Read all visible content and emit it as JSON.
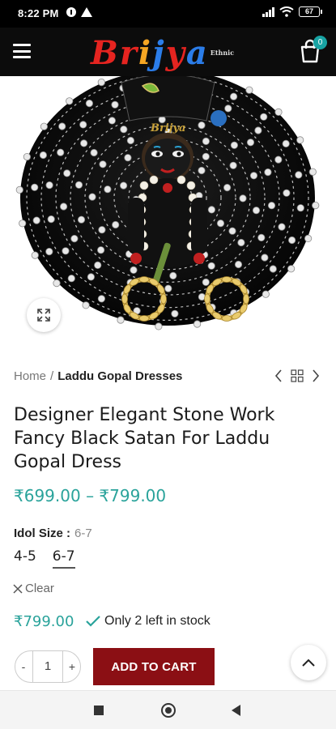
{
  "status_bar": {
    "time": "8:22 PM",
    "battery": "67"
  },
  "header": {
    "logo": {
      "letters": [
        "B",
        "r",
        "i",
        "j",
        "y",
        "a"
      ],
      "trademark": "Ethnic",
      "colors": [
        "#e52420",
        "#e52420",
        "#f5a623",
        "#2b7de9",
        "#e52420",
        "#2b7de9"
      ]
    },
    "cart_count": "0"
  },
  "breadcrumb": {
    "home": "Home",
    "separator": "/",
    "current": "Laddu Gopal Dresses"
  },
  "product": {
    "title": "Designer Elegant Stone Work Fancy Black Satan For Laddu Gopal Dress",
    "price_range": "₹699.00 – ₹799.00",
    "size_label": "Idol Size :",
    "size_selected": "6-7",
    "sizes": [
      "4-5",
      "6-7"
    ],
    "clear_label": "Clear",
    "variation_price": "₹799.00",
    "stock_text": "Only 2 left in stock",
    "quantity": "1",
    "qty_minus": "-",
    "qty_plus": "+",
    "add_to_cart": "ADD TO CART"
  },
  "colors": {
    "accent": "#2aa39b",
    "cart_button": "#8b0f14",
    "badge": "#18a3a3"
  }
}
